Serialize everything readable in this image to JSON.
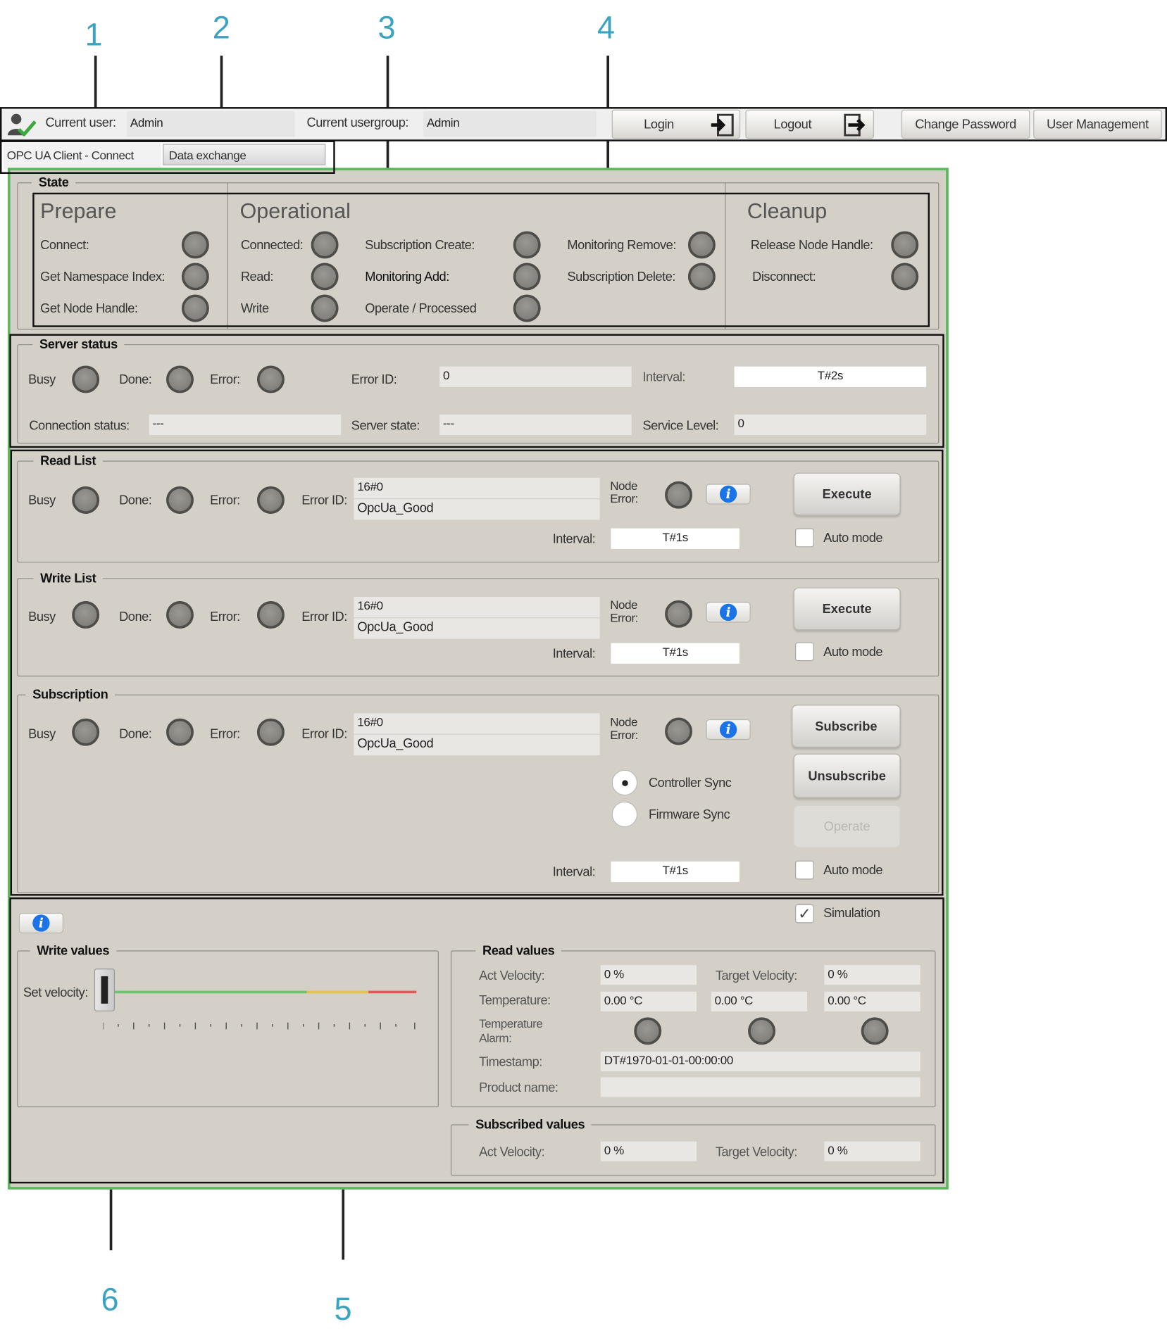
{
  "callouts": [
    "1",
    "2",
    "3",
    "4",
    "5",
    "6"
  ],
  "userbar": {
    "current_user_label": "Current user:",
    "current_user_value": "Admin",
    "current_usergroup_label": "Current usergroup:",
    "current_usergroup_value": "Admin",
    "login_label": "Login",
    "logout_label": "Logout",
    "change_password_label": "Change Password",
    "user_management_label": "User Management"
  },
  "tabs": [
    "OPC UA Client - Connect",
    "Data exchange"
  ],
  "state": {
    "title": "State",
    "prepare": {
      "title": "Prepare",
      "items": [
        "Connect:",
        "Get Namespace Index:",
        "Get Node Handle:"
      ]
    },
    "operational": {
      "title": "Operational",
      "col1": [
        "Connected:",
        "Read:",
        "Write"
      ],
      "col2": [
        "Subscription Create:",
        "Monitoring Add:",
        "Operate / Processed"
      ],
      "col3": [
        "Monitoring Remove:",
        "Subscription Delete:"
      ]
    },
    "cleanup": {
      "title": "Cleanup",
      "items": [
        "Release Node Handle:",
        "Disconnect:"
      ]
    }
  },
  "server_status": {
    "title": "Server status",
    "busy_label": "Busy",
    "done_label": "Done:",
    "error_label": "Error:",
    "error_id_label": "Error ID:",
    "error_id_value": "0",
    "interval_label": "Interval:",
    "interval_value": "T#2s",
    "connection_status_label": "Connection status:",
    "connection_status_value": "---",
    "server_state_label": "Server state:",
    "server_state_value": "---",
    "service_level_label": "Service Level:",
    "service_level_value": "0"
  },
  "read_list": {
    "title": "Read List",
    "busy_label": "Busy",
    "done_label": "Done:",
    "error_label": "Error:",
    "error_id_label": "Error ID:",
    "error_code": "16#0",
    "error_text": "OpcUa_Good",
    "node_error_label_1": "Node",
    "node_error_label_2": "Error:",
    "execute_label": "Execute",
    "auto_mode_label": "Auto mode",
    "interval_label": "Interval:",
    "interval_value": "T#1s"
  },
  "write_list": {
    "title": "Write List",
    "busy_label": "Busy",
    "done_label": "Done:",
    "error_label": "Error:",
    "error_id_label": "Error ID:",
    "error_code": "16#0",
    "error_text": "OpcUa_Good",
    "node_error_label_1": "Node",
    "node_error_label_2": "Error:",
    "execute_label": "Execute",
    "auto_mode_label": "Auto mode",
    "interval_label": "Interval:",
    "interval_value": "T#1s"
  },
  "subscription": {
    "title": "Subscription",
    "busy_label": "Busy",
    "done_label": "Done:",
    "error_label": "Error:",
    "error_id_label": "Error ID:",
    "error_code": "16#0",
    "error_text": "OpcUa_Good",
    "node_error_label_1": "Node",
    "node_error_label_2": "Error:",
    "subscribe_label": "Subscribe",
    "unsubscribe_label": "Unsubscribe",
    "operate_label": "Operate",
    "controller_sync_label": "Controller Sync",
    "firmware_sync_label": "Firmware Sync",
    "selected_sync": "Controller Sync",
    "interval_label": "Interval:",
    "interval_value": "T#1s",
    "auto_mode_label": "Auto mode"
  },
  "values": {
    "simulation_label": "Simulation",
    "simulation_checked": true,
    "write_values": {
      "title": "Write values",
      "set_velocity_label": "Set velocity:",
      "slider_level": 0
    },
    "read_values": {
      "title": "Read values",
      "act_velocity_label": "Act Velocity:",
      "act_velocity_value": "0 %",
      "target_velocity_label": "Target Velocity:",
      "target_velocity_value": "0 %",
      "temperature_label": "Temperature:",
      "temperatures": [
        "0.00 °C",
        "0.00 °C",
        "0.00 °C"
      ],
      "temperature_alarm_label_1": "Temperature",
      "temperature_alarm_label_2": "Alarm:",
      "timestamp_label": "Timestamp:",
      "timestamp_value": "DT#1970-01-01-00:00:00",
      "product_name_label": "Product name:",
      "product_name_value": ""
    },
    "subscribed_values": {
      "title": "Subscribed values",
      "act_velocity_label": "Act Velocity:",
      "act_velocity_value": "0 %",
      "target_velocity_label": "Target Velocity:",
      "target_velocity_value": "0 %"
    }
  },
  "colors": {
    "panel_bg": "#d4d0c8",
    "panel_border": "#5cb85c",
    "callout": "#3aa3c2",
    "info_blue": "#1a74e8"
  }
}
